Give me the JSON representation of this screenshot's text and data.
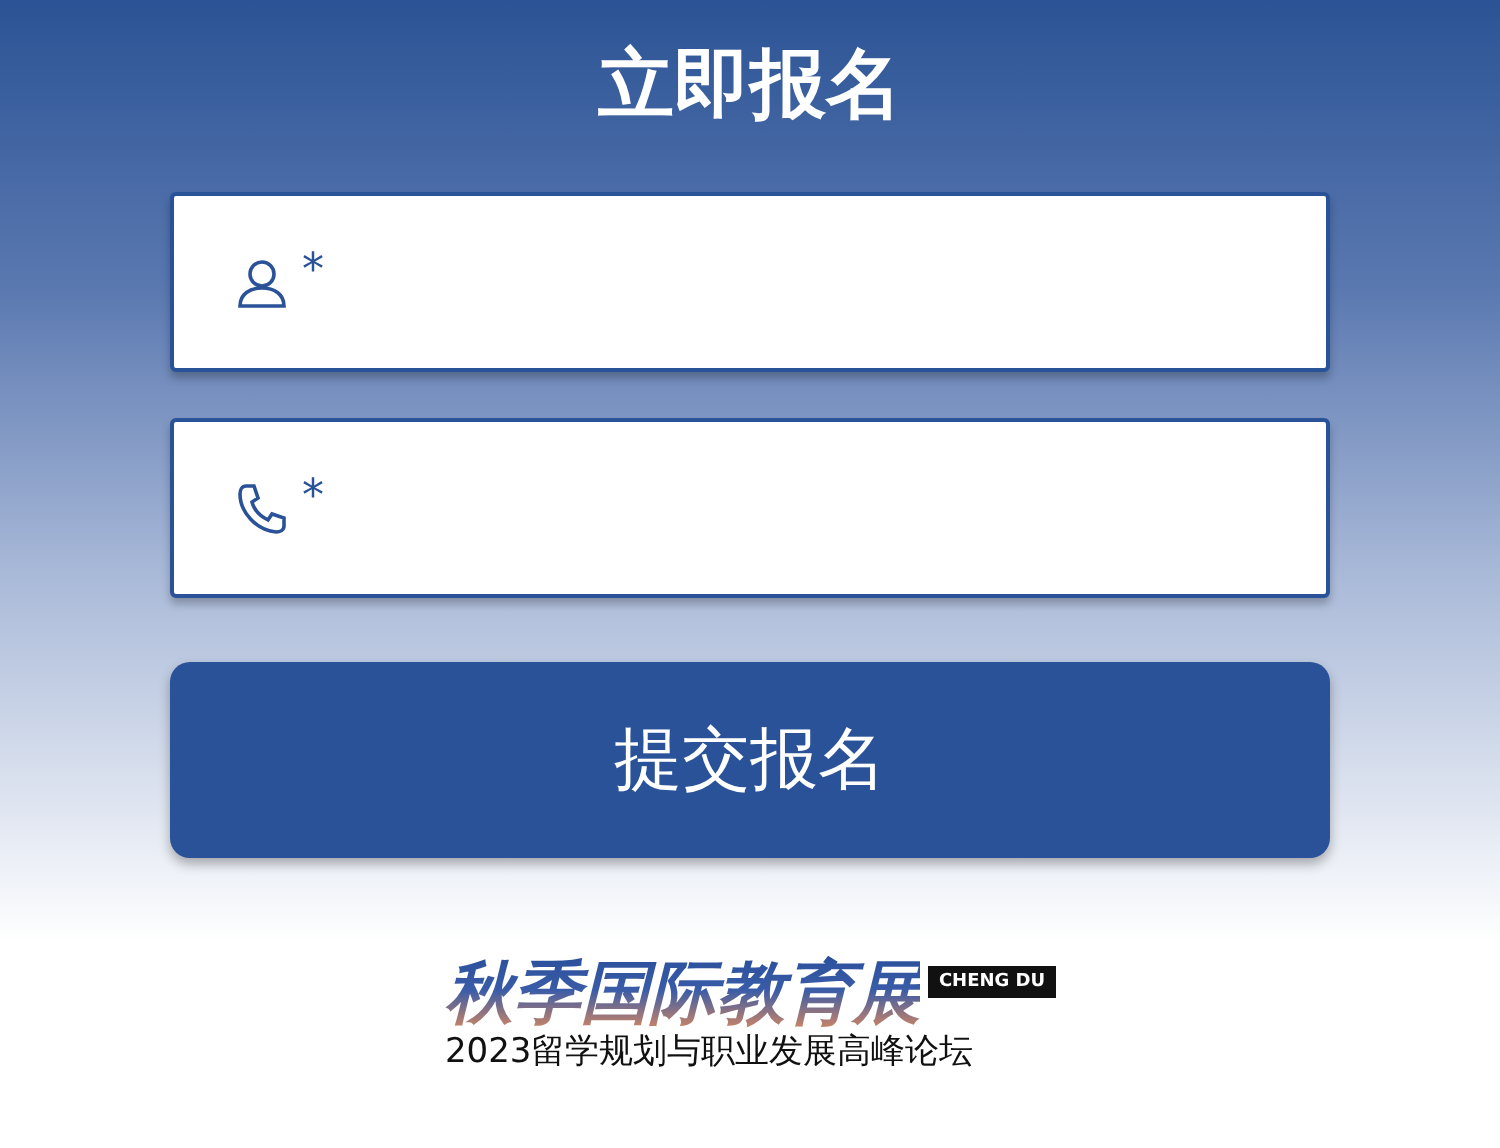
{
  "title": "立即报名",
  "fields": [
    {
      "kind": "person",
      "required_mark": "*"
    },
    {
      "kind": "phone",
      "required_mark": "*"
    }
  ],
  "submit_button": "提交报名",
  "logo": {
    "headline": "秋季国际教育展",
    "tag": "CHENG DU",
    "subtitle": "2023留学规划与职业发展高峰论坛"
  }
}
